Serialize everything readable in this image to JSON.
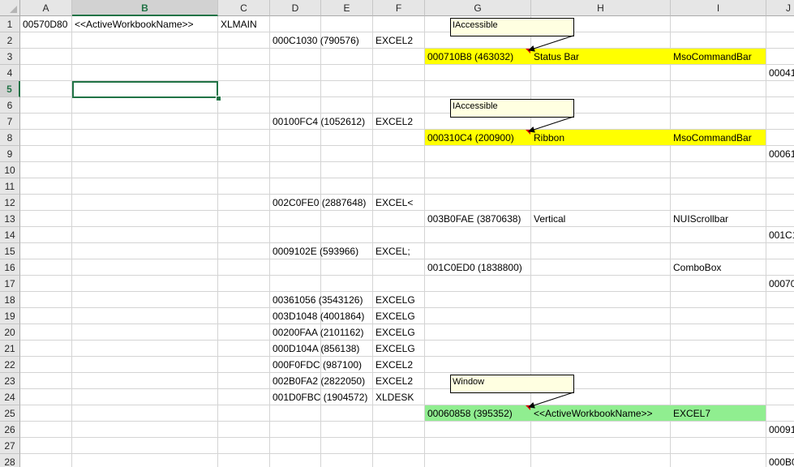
{
  "colors": {
    "highlight_yellow": "#ffff00",
    "highlight_green": "#90ee90",
    "grid": "#d4d4d4",
    "header_bg": "#e6e6e6",
    "selection": "#217346",
    "comment_bg": "#ffffe1",
    "comment_indicator": "#e00000"
  },
  "active_cell": "B5",
  "columns": [
    "A",
    "B",
    "C",
    "D",
    "E",
    "F",
    "G",
    "H",
    "I",
    "J"
  ],
  "rows": [
    "1",
    "2",
    "3",
    "4",
    "5",
    "6",
    "7",
    "8",
    "9",
    "10",
    "11",
    "12",
    "13",
    "14",
    "15",
    "16",
    "17",
    "18",
    "19",
    "20",
    "21",
    "22",
    "23",
    "24",
    "25",
    "26",
    "27",
    "28"
  ],
  "cells": [
    {
      "ref": "A1",
      "text": "00570D80"
    },
    {
      "ref": "B1",
      "text": "<<ActiveWorkbookName>>"
    },
    {
      "ref": "C1",
      "text": "XLMAIN"
    },
    {
      "ref": "D2",
      "text": "000C1030 (790576)"
    },
    {
      "ref": "F2",
      "text": "EXCEL2"
    },
    {
      "ref": "G3",
      "text": "000710B8 (463032)"
    },
    {
      "ref": "H3",
      "text": "Status Bar"
    },
    {
      "ref": "I3",
      "text": "MsoCommandBar"
    },
    {
      "ref": "J4",
      "text": "00041"
    },
    {
      "ref": "D7",
      "text": "00100FC4 (1052612)"
    },
    {
      "ref": "F7",
      "text": "EXCEL2"
    },
    {
      "ref": "G8",
      "text": "000310C4 (200900)"
    },
    {
      "ref": "H8",
      "text": "Ribbon"
    },
    {
      "ref": "I8",
      "text": "MsoCommandBar"
    },
    {
      "ref": "J9",
      "text": "00061"
    },
    {
      "ref": "D12",
      "text": "002C0FE0 (2887648)"
    },
    {
      "ref": "F12",
      "text": "EXCEL<"
    },
    {
      "ref": "G13",
      "text": "003B0FAE (3870638)"
    },
    {
      "ref": "H13",
      "text": "Vertical"
    },
    {
      "ref": "I13",
      "text": "NUIScrollbar"
    },
    {
      "ref": "J14",
      "text": "001C1"
    },
    {
      "ref": "D15",
      "text": "0009102E (593966)"
    },
    {
      "ref": "F15",
      "text": "EXCEL;"
    },
    {
      "ref": "G16",
      "text": "001C0ED0 (1838800)"
    },
    {
      "ref": "I16",
      "text": "ComboBox"
    },
    {
      "ref": "J17",
      "text": "00070"
    },
    {
      "ref": "D18",
      "text": "00361056 (3543126)"
    },
    {
      "ref": "F18",
      "text": "EXCELG"
    },
    {
      "ref": "D19",
      "text": "003D1048 (4001864)"
    },
    {
      "ref": "F19",
      "text": "EXCELG"
    },
    {
      "ref": "D20",
      "text": "00200FAA (2101162)"
    },
    {
      "ref": "F20",
      "text": "EXCELG"
    },
    {
      "ref": "D21",
      "text": "000D104A (856138)"
    },
    {
      "ref": "F21",
      "text": "EXCELG"
    },
    {
      "ref": "D22",
      "text": "000F0FDC (987100)"
    },
    {
      "ref": "F22",
      "text": "EXCEL2"
    },
    {
      "ref": "D23",
      "text": "002B0FA2 (2822050)"
    },
    {
      "ref": "F23",
      "text": "EXCEL2"
    },
    {
      "ref": "D24",
      "text": "001D0FBC (1904572)"
    },
    {
      "ref": "F24",
      "text": "XLDESK"
    },
    {
      "ref": "G25",
      "text": "00060858 (395352)"
    },
    {
      "ref": "H25",
      "text": "<<ActiveWorkbookName>>"
    },
    {
      "ref": "I25",
      "text": "EXCEL7"
    },
    {
      "ref": "J26",
      "text": "00091"
    },
    {
      "ref": "J28",
      "text": "000B0"
    }
  ],
  "row_fills": [
    {
      "row": "3",
      "color": "#ffff00"
    },
    {
      "row": "8",
      "color": "#ffff00"
    },
    {
      "row": "25",
      "color": "#90ee90"
    }
  ],
  "comments": [
    {
      "cell": "G3",
      "text": "IAccessible"
    },
    {
      "cell": "G8",
      "text": "IAccessible"
    },
    {
      "cell": "G25",
      "text": "Window"
    }
  ]
}
